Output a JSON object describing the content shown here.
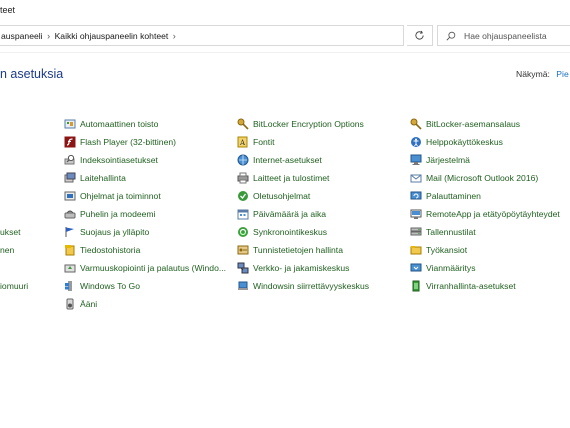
{
  "window": {
    "title": "teet"
  },
  "address": {
    "crumbs": [
      "Ohjauspaneeli",
      "Kaikki ohjauspaneelin kohteet"
    ],
    "crumb_visible": [
      "auspaneeli",
      "Kaikki ohjauspaneelin kohteet"
    ],
    "search_placeholder": "Hae ohjauspaneelista"
  },
  "heading": "n asetuksia",
  "view_by": {
    "label": "Näkymä:",
    "value": "Pie"
  },
  "columns": [
    [
      "",
      "",
      "",
      "",
      "",
      "",
      "ukset",
      "nen",
      "",
      "iomuuri",
      ""
    ],
    [
      "Automaattinen toisto",
      "Flash Player (32-bittinen)",
      "Indeksointiasetukset",
      "Laitehallinta",
      "Ohjelmat ja toiminnot",
      "Puhelin ja modeemi",
      "Suojaus ja ylläpito",
      "Tiedostohistoria",
      "Varmuuskopiointi ja palautus (Windo...",
      "Windows To Go",
      "Ääni"
    ],
    [
      "BitLocker Encryption Options",
      "Fontit",
      "Internet-asetukset",
      "Laitteet ja tulostimet",
      "Oletusohjelmat",
      "Päivämäärä ja aika",
      "Synkronointikeskus",
      "Tunnistetietojen hallinta",
      "Verkko- ja jakamiskeskus",
      "Windowsin siirrettävyyskeskus"
    ],
    [
      "BitLocker-asemansalaus",
      "Helppokäyttökeskus",
      "Järjestelmä",
      "Mail (Microsoft Outlook 2016)",
      "Palauttaminen",
      "RemoteApp ja etätyöpöytäyhteydet",
      "Tallennustilat",
      "Työkansiot",
      "Vianmääritys",
      "Virranhallinta-asetukset"
    ]
  ],
  "icons": [
    [
      "",
      "",
      "",
      "",
      "",
      "",
      "",
      "",
      "",
      "",
      ""
    ],
    [
      "autoplay-icon",
      "flash-icon",
      "indexing-icon",
      "device-manager-icon",
      "programs-icon",
      "phone-modem-icon",
      "security-flag-icon",
      "file-history-icon",
      "backup-icon",
      "windows-to-go-icon",
      "sound-icon"
    ],
    [
      "bitlocker-options-icon",
      "fonts-icon",
      "internet-options-icon",
      "devices-printers-icon",
      "default-programs-icon",
      "date-time-icon",
      "sync-center-icon",
      "credential-manager-icon",
      "network-sharing-icon",
      "mobility-center-icon"
    ],
    [
      "bitlocker-icon",
      "ease-of-access-icon",
      "system-icon",
      "mail-icon",
      "recovery-icon",
      "remoteapp-icon",
      "storage-spaces-icon",
      "work-folders-icon",
      "troubleshooting-icon",
      "power-options-icon"
    ]
  ],
  "colors": {
    "link": "#1f5f1f",
    "heading": "#1e3a8a",
    "accent": "#1a6fc0"
  }
}
